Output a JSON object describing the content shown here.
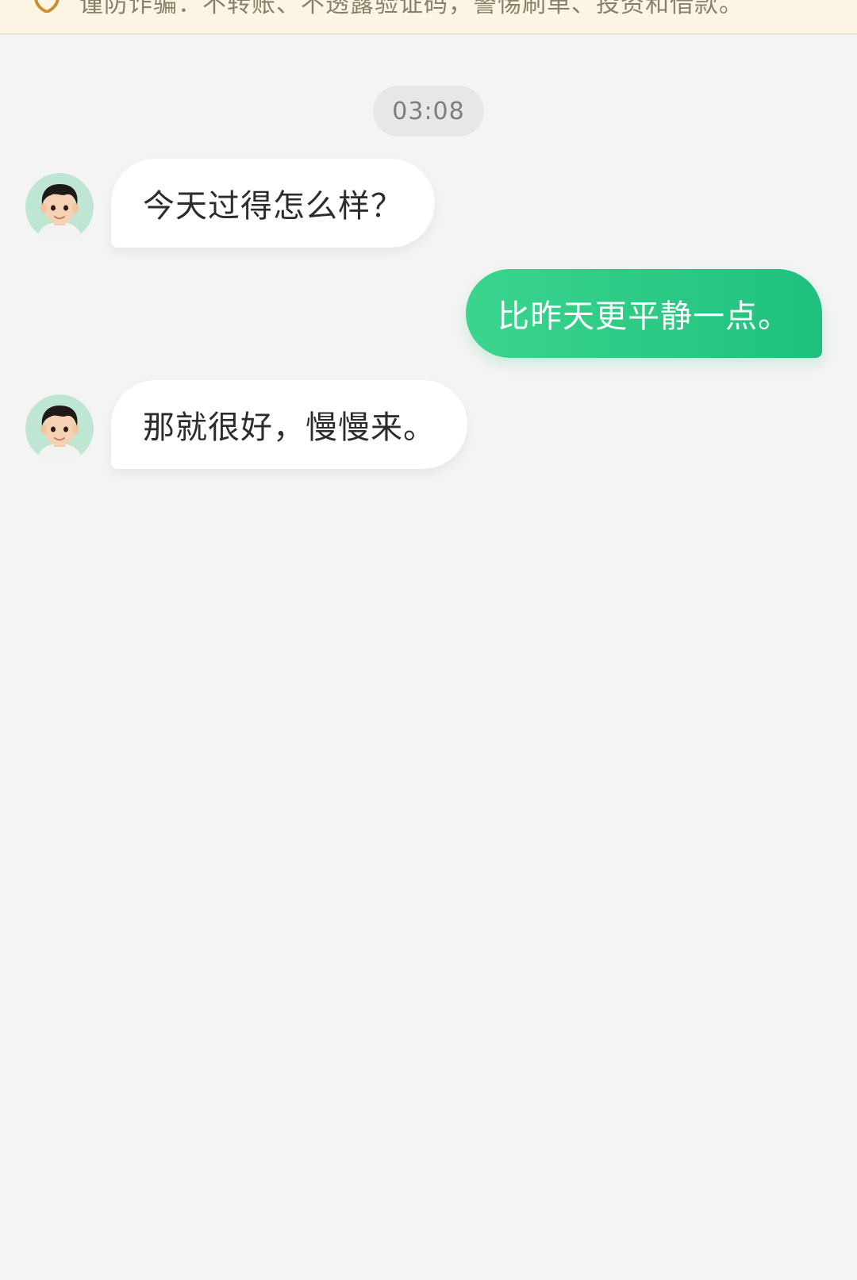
{
  "warning": {
    "icon": "shield-icon",
    "text": "谨防诈骗：不转账、不透露验证码，警惕刷单、投资和借款。"
  },
  "chat": {
    "timestamp": "03:08",
    "messages": [
      {
        "sender": "other",
        "avatar": "avatar-boy-icon",
        "text": "今天过得怎么样？"
      },
      {
        "sender": "me",
        "text": "比昨天更平静一点。"
      },
      {
        "sender": "other",
        "avatar": "avatar-boy-icon",
        "text": "那就很好，慢慢来。"
      }
    ]
  },
  "colors": {
    "background": "#f3f4f3",
    "outgoing_bubble": "#2ccb86",
    "incoming_bubble": "#ffffff",
    "banner": "#fdf5e4",
    "banner_icon": "#c8902e"
  }
}
